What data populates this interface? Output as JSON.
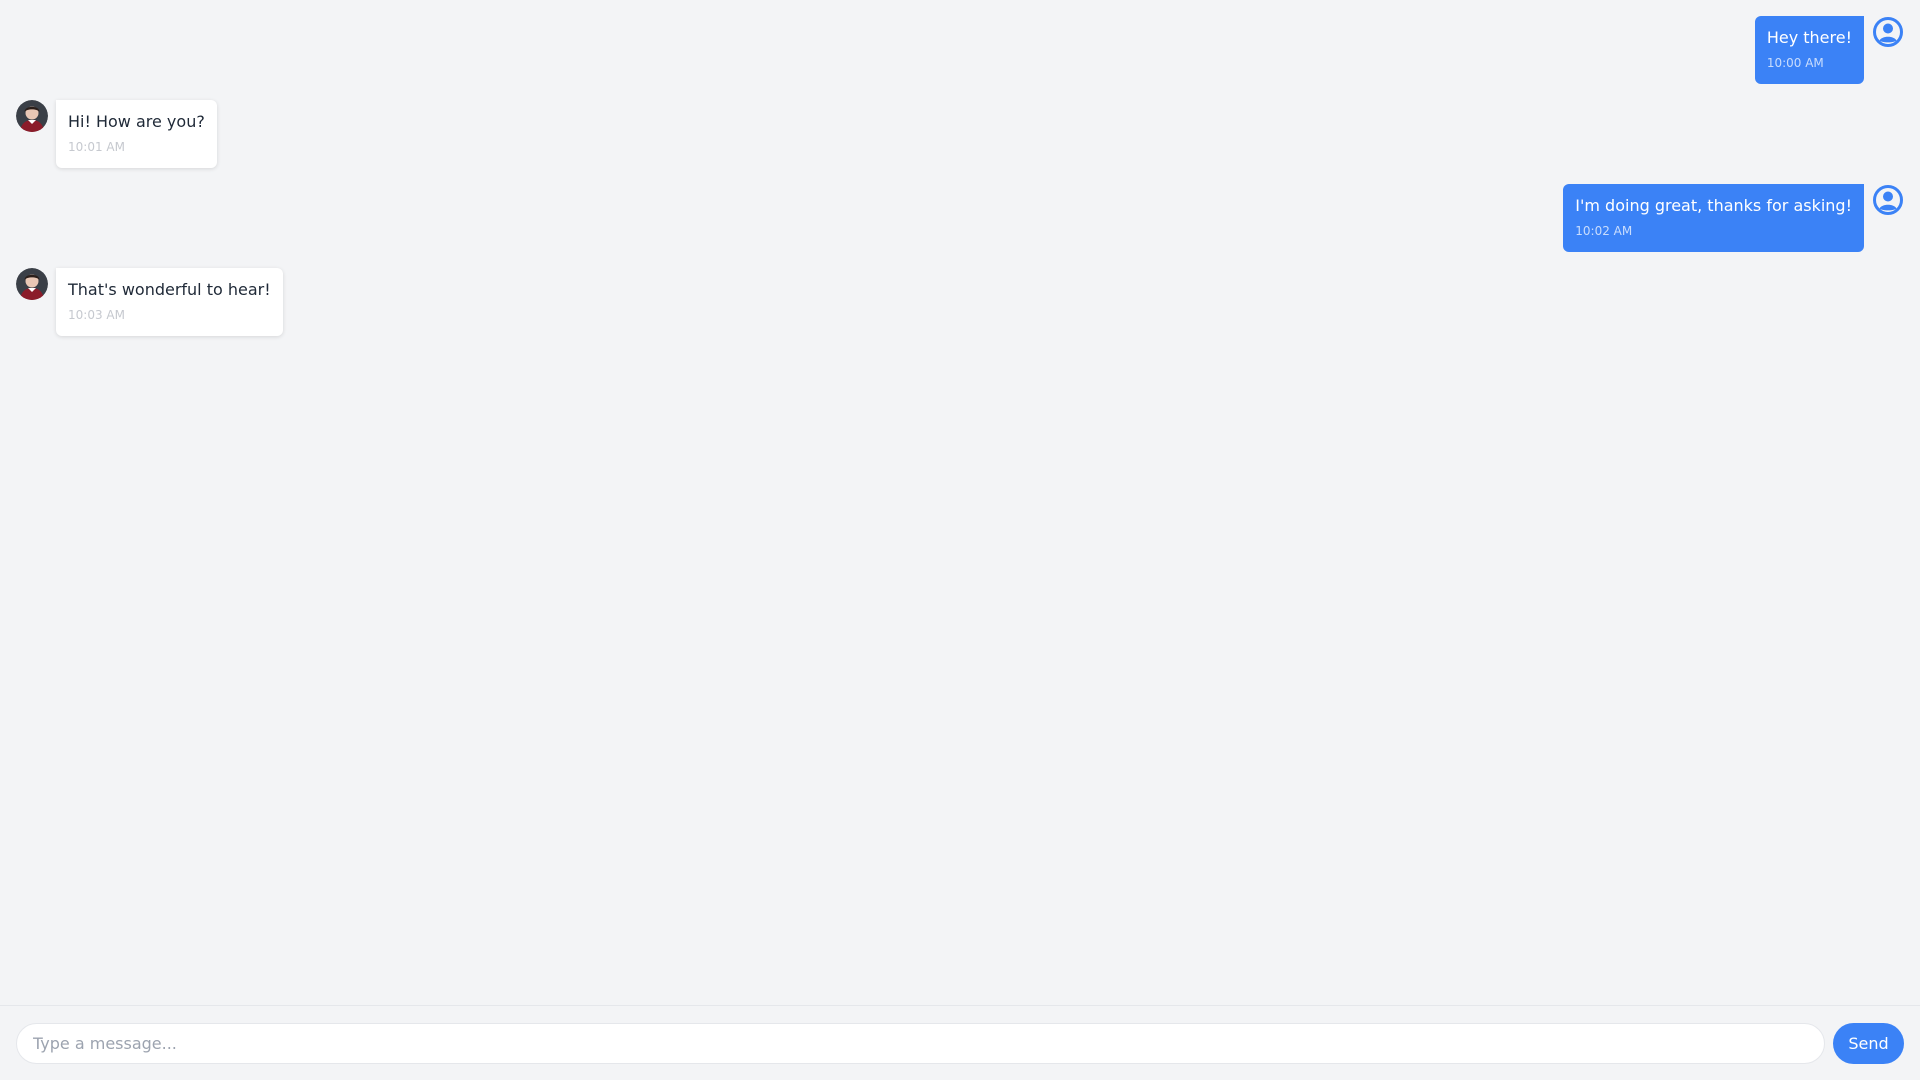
{
  "messages": [
    {
      "direction": "sent",
      "text": "Hey there!",
      "time": "10:00 AM",
      "avatar_icon": "user-circle-icon"
    },
    {
      "direction": "received",
      "text": "Hi! How are you?",
      "time": "10:01 AM",
      "avatar_icon": "contact-avatar"
    },
    {
      "direction": "sent",
      "text": "I'm doing great, thanks for asking!",
      "time": "10:02 AM",
      "avatar_icon": "user-circle-icon"
    },
    {
      "direction": "received",
      "text": "That's wonderful to hear!",
      "time": "10:03 AM",
      "avatar_icon": "contact-avatar"
    }
  ],
  "composer": {
    "placeholder": "Type a message...",
    "value": "",
    "send_label": "Send"
  },
  "colors": {
    "accent": "#3b82f6",
    "background": "#f3f4f6",
    "received_bubble": "#ffffff"
  }
}
